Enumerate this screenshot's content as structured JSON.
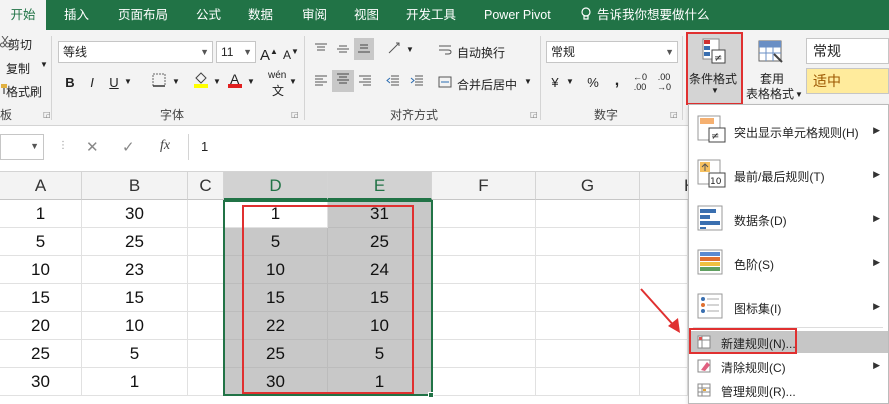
{
  "tabs": [
    "开始",
    "插入",
    "页面布局",
    "公式",
    "数据",
    "审阅",
    "视图",
    "开发工具",
    "Power Pivot",
    "告诉我你想要做什么"
  ],
  "clipboard": {
    "cut": "剪切",
    "copy": "复制",
    "format_painter": "格式刷",
    "group": "板"
  },
  "font": {
    "name": "等线",
    "size": "11",
    "grow": "A",
    "shrink": "A",
    "bold": "B",
    "italic": "I",
    "underline": "U",
    "fill_letter": "A",
    "color_letter": "A",
    "phonetic": "wén",
    "group": "字体"
  },
  "alignment": {
    "wrap": "自动换行",
    "merge": "合并后居中",
    "group": "对齐方式"
  },
  "number": {
    "format": "常规",
    "currency": "¥",
    "percent": "%",
    "comma": ",",
    "group": "数字"
  },
  "styles": {
    "conditional": "条件格式",
    "table_line1": "套用",
    "table_line2": "表格格式",
    "style_normal": "常规",
    "style_neutral": "适中"
  },
  "formula": {
    "cancel": "✕",
    "enter": "✓",
    "fx": "fx",
    "value": "1"
  },
  "columns": [
    "A",
    "B",
    "C",
    "D",
    "E",
    "F",
    "G",
    "H"
  ],
  "rows": [
    {
      "a": "1",
      "b": "30",
      "d": "1",
      "e": "31"
    },
    {
      "a": "5",
      "b": "25",
      "d": "5",
      "e": "25"
    },
    {
      "a": "10",
      "b": "23",
      "d": "10",
      "e": "24"
    },
    {
      "a": "15",
      "b": "15",
      "d": "15",
      "e": "15"
    },
    {
      "a": "20",
      "b": "10",
      "d": "22",
      "e": "10"
    },
    {
      "a": "25",
      "b": "5",
      "d": "25",
      "e": "5"
    },
    {
      "a": "30",
      "b": "1",
      "d": "30",
      "e": "1"
    }
  ],
  "menu": {
    "highlight": "突出显示单元格规则(H)",
    "topbottom": "最前/最后规则(T)",
    "databars": "数据条(D)",
    "colorscales": "色阶(S)",
    "iconsets": "图标集(I)",
    "newrule": "新建规则(N)...",
    "clearrules": "清除规则(C)",
    "managerules": "管理规则(R)..."
  },
  "colors": {
    "excel_green": "#217346",
    "annotation_red": "#e03030",
    "selection_gray": "#c8c8c8"
  }
}
